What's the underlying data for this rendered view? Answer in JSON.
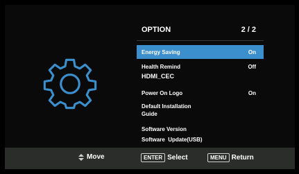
{
  "menu": {
    "title": "OPTION",
    "page": "2 / 2",
    "items": [
      {
        "label": "Energy Saving",
        "value": "On",
        "selected": true
      },
      {
        "label": "Health Remind",
        "value": "Off"
      },
      {
        "label": "HDMI_CEC",
        "value": ""
      },
      {
        "label": "Power On Logo",
        "value": "On"
      },
      {
        "label": "Default Installation Guide",
        "value": ""
      },
      {
        "label": "Software Version",
        "value": ""
      },
      {
        "label": "Software  Update(USB)",
        "value": ""
      }
    ]
  },
  "footer": {
    "move_label": "Move",
    "select_key": "ENTER",
    "select_label": "Select",
    "return_key": "MENU",
    "return_label": "Return"
  },
  "icons": {
    "main": "gear-icon",
    "move": "up-down-arrows-icon"
  },
  "colors": {
    "accent": "#3c8fcd",
    "gear": "#3c8fcd",
    "footer_bg": "#2a2d2a"
  }
}
